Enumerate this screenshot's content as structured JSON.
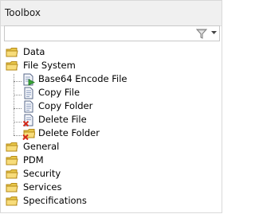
{
  "window": {
    "title": "Toolbox"
  },
  "filter": {
    "value": "",
    "placeholder": ""
  },
  "icons": {
    "filter": "funnel-icon",
    "dropdown": "chevron-down-icon",
    "folder": "folder-icon",
    "file_run": "file-run-icon",
    "file": "file-icon",
    "file_delete": "file-delete-icon",
    "folder_delete": "folder-delete-icon"
  },
  "colors": {
    "folder": "#e8c74a",
    "folder_dark": "#c49a1c",
    "delete_red": "#d42a1a"
  },
  "tree": {
    "data": "Data",
    "file_system": {
      "label": "File System",
      "children": [
        "Base64 Encode File",
        "Copy File",
        "Copy Folder",
        "Delete File",
        "Delete Folder"
      ]
    },
    "general": "General",
    "pdm": "PDM",
    "security": "Security",
    "services": "Services",
    "specifications": "Specifications"
  }
}
